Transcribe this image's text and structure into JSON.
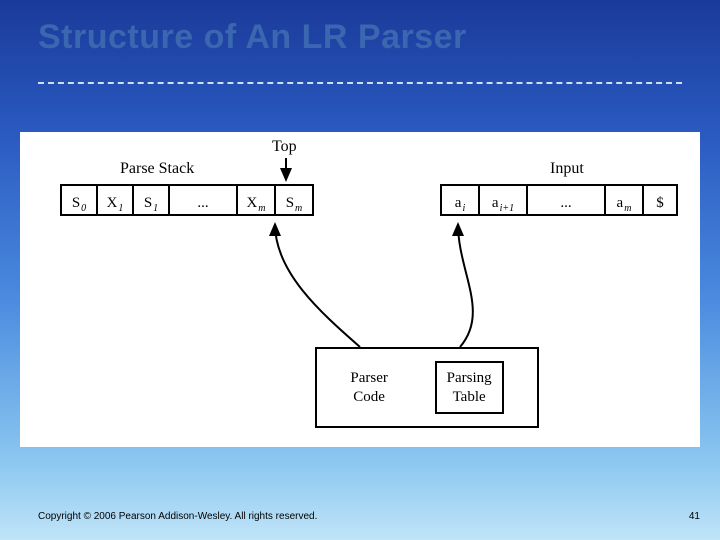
{
  "title": "Structure of An LR Parser",
  "footer": {
    "copyright": "Copyright © 2006 Pearson Addison-Wesley. All rights reserved.",
    "page_number": "41"
  },
  "diagram": {
    "labels": {
      "top": "Top",
      "parse_stack": "Parse Stack",
      "input": "Input"
    },
    "parse_stack_cells": [
      {
        "base": "S",
        "sub": "0"
      },
      {
        "base": "X",
        "sub": "1"
      },
      {
        "base": "S",
        "sub": "1"
      },
      {
        "base": "...",
        "sub": ""
      },
      {
        "base": "X",
        "sub": "m"
      },
      {
        "base": "S",
        "sub": "m"
      }
    ],
    "input_cells": [
      {
        "base": "a",
        "sub": "i"
      },
      {
        "base": "a",
        "sub": "i+1"
      },
      {
        "base": "...",
        "sub": ""
      },
      {
        "base": "a",
        "sub": "m"
      },
      {
        "base": "$",
        "sub": ""
      }
    ],
    "parser_box": {
      "code": "Parser\nCode",
      "table": "Parsing\nTable"
    }
  }
}
